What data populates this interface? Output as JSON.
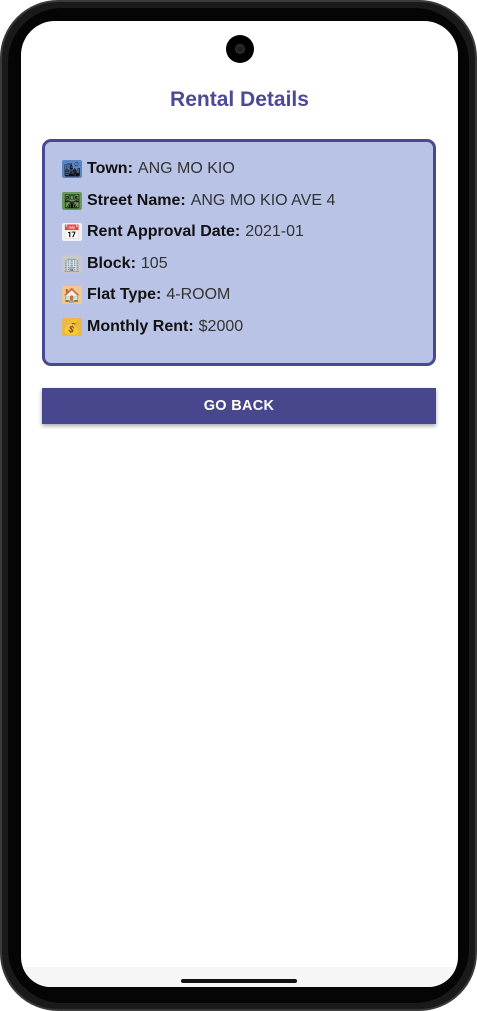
{
  "header": {
    "title": "Rental Details"
  },
  "details": [
    {
      "icon": "cityscape-icon",
      "glyph": "🏙",
      "glyph_bg": "#5b86c4",
      "label": "Town:",
      "value": "ANG MO KIO"
    },
    {
      "icon": "road-icon",
      "glyph": "🛣",
      "glyph_bg": "#6a9a58",
      "label": "Street Name:",
      "value": "ANG MO KIO AVE 4"
    },
    {
      "icon": "calendar-icon",
      "glyph": "📅",
      "glyph_bg": "#f2f2f2",
      "label": "Rent Approval Date:",
      "value": "2021-01"
    },
    {
      "icon": "office-building-icon",
      "glyph": "🏢",
      "glyph_bg": "#c9c9c9",
      "label": "Block:",
      "value": "105"
    },
    {
      "icon": "house-icon",
      "glyph": "🏠",
      "glyph_bg": "#f0c890",
      "label": "Flat Type:",
      "value": "4-ROOM"
    },
    {
      "icon": "money-bag-icon",
      "glyph": "💰",
      "glyph_bg": "#e8b84a",
      "label": "Monthly Rent:",
      "value": "$2000"
    }
  ],
  "actions": {
    "go_back_label": "GO BACK"
  },
  "colors": {
    "accent": "#48468c",
    "card_background": "#b9c3e6",
    "title": "#4a4a96"
  }
}
